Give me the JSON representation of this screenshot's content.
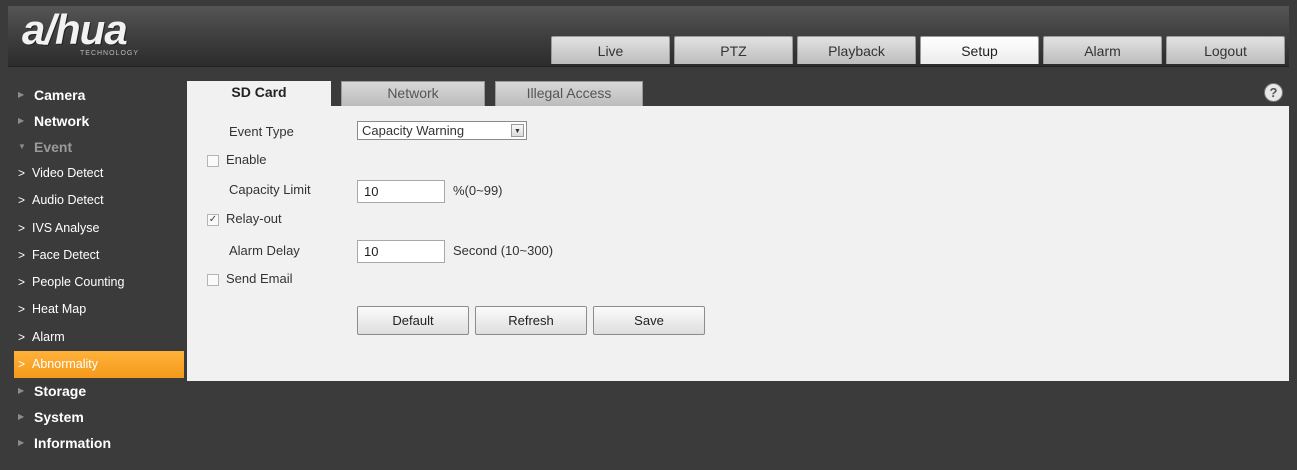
{
  "brand": {
    "name": "a/hua",
    "sub": "TECHNOLOGY"
  },
  "nav": {
    "tabs": [
      "Live",
      "PTZ",
      "Playback",
      "Setup",
      "Alarm",
      "Logout"
    ],
    "active": "Setup"
  },
  "sidebar": {
    "items": [
      {
        "label": "Camera"
      },
      {
        "label": "Network"
      },
      {
        "label": "Event",
        "expanded": true
      },
      {
        "label": "Video Detect"
      },
      {
        "label": "Audio Detect"
      },
      {
        "label": "IVS Analyse"
      },
      {
        "label": "Face Detect"
      },
      {
        "label": "People Counting"
      },
      {
        "label": "Heat Map"
      },
      {
        "label": "Alarm"
      },
      {
        "label": "Abnormality",
        "active": true
      },
      {
        "label": "Storage"
      },
      {
        "label": "System"
      },
      {
        "label": "Information"
      }
    ]
  },
  "tabs": {
    "items": [
      "SD Card",
      "Network",
      "Illegal Access"
    ],
    "active": "SD Card"
  },
  "form": {
    "event_type_label": "Event Type",
    "event_type_value": "Capacity Warning",
    "enable_label": "Enable",
    "enable_checked": false,
    "capacity_limit_label": "Capacity Limit",
    "capacity_limit_value": "10",
    "capacity_limit_hint": "%(0~99)",
    "relay_out_label": "Relay-out",
    "relay_out_checked": true,
    "alarm_delay_label": "Alarm Delay",
    "alarm_delay_value": "10",
    "alarm_delay_hint": "Second (10~300)",
    "send_email_label": "Send Email",
    "send_email_checked": false
  },
  "buttons": {
    "default": "Default",
    "refresh": "Refresh",
    "save": "Save"
  },
  "colors": {
    "accent": "#f7a020",
    "background": "#3b3b3b",
    "panel": "#f1f1f1"
  }
}
